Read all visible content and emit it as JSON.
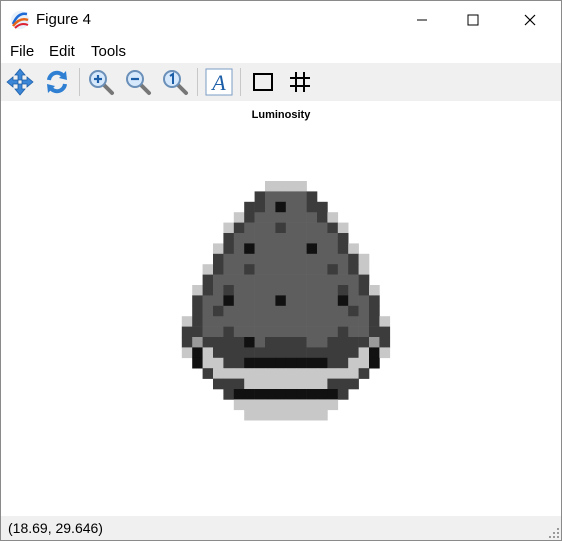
{
  "window": {
    "title": "Figure 4"
  },
  "menu": {
    "file": "File",
    "edit": "Edit",
    "tools": "Tools"
  },
  "toolbar": {
    "buttons": [
      {
        "icon": "pan-arrows-icon"
      },
      {
        "icon": "refresh-icon"
      },
      {
        "icon": "zoom-in-icon"
      },
      {
        "icon": "zoom-out-icon"
      },
      {
        "icon": "zoom-reset-icon"
      },
      {
        "icon": "text-annotation-icon",
        "glyph": "A"
      },
      {
        "icon": "rectangle-select-icon"
      },
      {
        "icon": "grid-toggle-icon"
      }
    ]
  },
  "plot": {
    "title": "Luminosity",
    "image_rows": [
      "..........LLLL..........",
      ".........DGGGGD.........",
      "........DDGKGGDD........",
      ".......LDGGGGGGDL.......",
      "......LDGGGDGGGGDL......",
      "......DGGGGGGGGGGD......",
      ".....LDGKGGGGGKGGDL.....",
      ".....DGGGGGGGGGGGGDL....",
      "....LDGGDGGGGGGGDGDL....",
      "....DGGGGGGGGGGGGGGD....",
      "...LDGDGGGGGGGGGGDGDL...",
      "...DGGKGGGGKGGGGGKGGD...",
      "...DGDGGGGGGGGGGGGDGD...",
      "..LDGGGGGGGGGGGGGGGGDL..",
      "..DDGGDGGGGGGGGGGDGGDD..",
      "..DMDDDDKGDDDDGGDDDDMD..",
      "..LKLDDDDDDDDDDDDDDLKL..",
      "...KLLDDKKKKKKKKDDLLK...",
      "....DLLLLLLLLLLLLLLD....",
      ".....DDDLLLLLLLLDDD.....",
      "......DKKKKKKKKKKD......",
      ".......LLLLLLLLLL.......",
      "........LLLLLLLL........"
    ]
  },
  "status": {
    "coordinates": "(18.69, 29.646)"
  },
  "colors": {
    "toolbar_bg": "#f0f0f0",
    "pixel_dark": "#2a2a2a",
    "pixel_mid": "#5e5e5e",
    "pixel_light": "#c8c8c8"
  }
}
